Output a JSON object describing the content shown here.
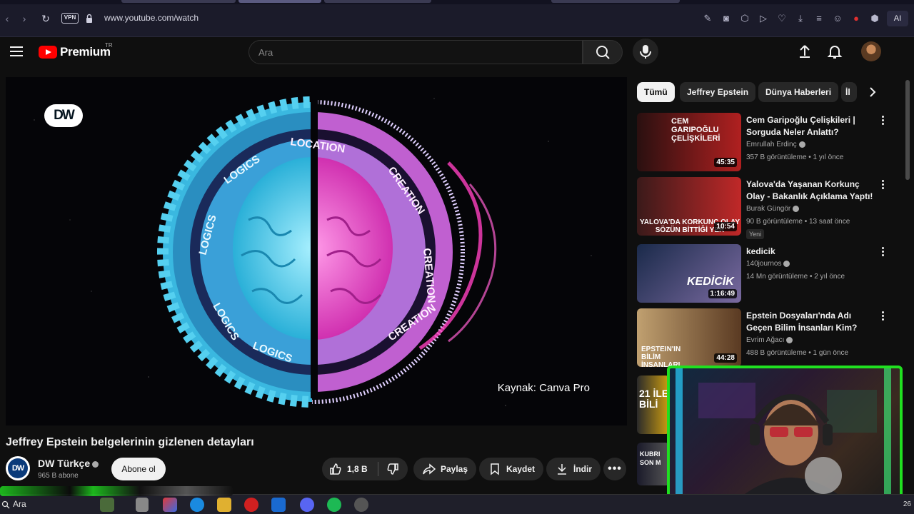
{
  "browser": {
    "url": "www.youtube.com/watch",
    "vpn_label": "VPN",
    "ai_label": "AI"
  },
  "header": {
    "logo_text": "Premium",
    "region": "TR",
    "search_placeholder": "Ara"
  },
  "video": {
    "watermark": "DW",
    "caption": "Kaynak: Canva Pro",
    "ring_words_left": [
      "LOGICS",
      "LOGICS",
      "LOGICS",
      "LOGICS"
    ],
    "ring_words_right": [
      "LOCATION",
      "CREATION",
      "CREATION",
      "CREATION"
    ]
  },
  "info": {
    "title": "Jeffrey Epstein belgelerinin gizlenen detayları",
    "channel_avatar": "DW",
    "channel_name": "DW Türkçe",
    "subscribers": "965 B abone",
    "subscribe_label": "Abone ol",
    "likes": "1,8 B",
    "share_label": "Paylaş",
    "save_label": "Kaydet",
    "download_label": "İndir"
  },
  "chips": [
    "Tümü",
    "Jeffrey Epstein",
    "Dünya Haberleri",
    "İl"
  ],
  "recommendations": [
    {
      "title": "Cem Garipoğlu Çelişkileri | Sorguda Neler Anlattı?",
      "channel": "Emrullah Erdinç",
      "meta": "357 B görüntüleme • 1 yıl önce",
      "duration": "45:35",
      "thumb_text": "CEM GARIPOĞLU ÇELİŞKİLERİ",
      "colors": [
        "#2a1010",
        "#b02020"
      ]
    },
    {
      "title": "Yalova'da Yaşanan Korkunç Olay - Bakanlık Açıklama Yaptı!",
      "channel": "Burak Güngör",
      "meta": "90 B görüntüleme • 13 saat önce",
      "badge": "Yeni",
      "duration": "10:54",
      "thumb_text": "YALOVA'DA KORKUNÇ OLAY SÖZÜN BİTTİĞİ YER",
      "colors": [
        "#3a1a1a",
        "#c02828"
      ]
    },
    {
      "title": "kedicik",
      "channel": "140journos",
      "meta": "14 Mn görüntüleme • 2 yıl önce",
      "duration": "1:16:49",
      "thumb_text": "KEDİCİK",
      "colors": [
        "#1a2a4a",
        "#7a6aa0"
      ]
    },
    {
      "title": "Epstein Dosyaları'nda Adı Geçen Bilim İnsanları Kim?",
      "channel": "Evrim Ağacı",
      "meta": "488 B görüntüleme • 1 gün önce",
      "duration": "44:28",
      "thumb_text": "EPSTEIN'IN BİLİM İNSANLARI",
      "colors": [
        "#5a3a22",
        "#c0a070"
      ]
    },
    {
      "title": "",
      "channel": "",
      "meta": "",
      "duration": "",
      "thumb_text": "21 İLE BİLİ",
      "colors": [
        "#2a2a2a",
        "#d0a010"
      ]
    },
    {
      "title": "",
      "channel": "",
      "meta": "",
      "duration": "",
      "thumb_text": "KUBRI SON M",
      "colors": [
        "#1a1a2a",
        "#555"
      ]
    }
  ],
  "taskbar": {
    "search": "Ara",
    "time": "26"
  },
  "colors": {
    "accent_red": "#ff0000",
    "bg": "#0f0f0f",
    "webcam_border": "#20e020"
  }
}
